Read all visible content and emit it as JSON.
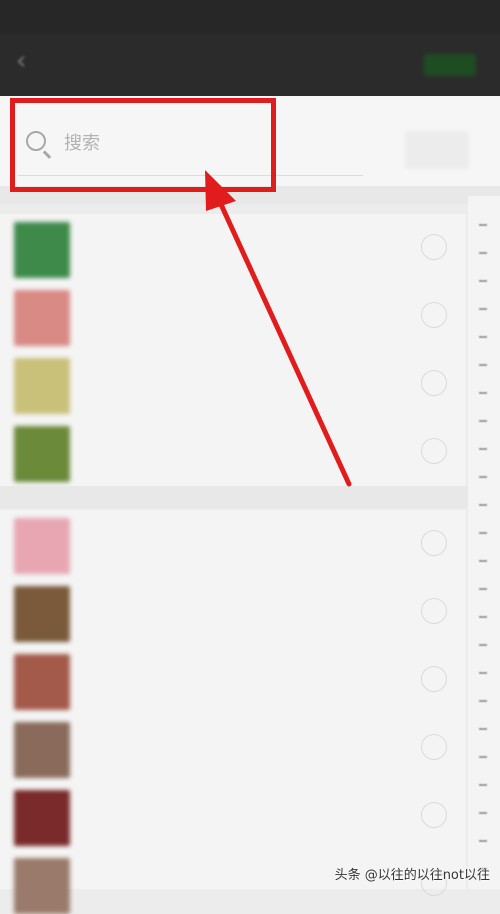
{
  "status_bar": {
    "carrier": "",
    "time": "",
    "battery": ""
  },
  "header": {
    "back_icon": "back-chevron-icon",
    "title": "",
    "done_label": ""
  },
  "search": {
    "placeholder": "搜索",
    "icon": "search-icon",
    "multi_select_label": ""
  },
  "sections": [
    {
      "header": "",
      "contacts": [
        {
          "name": "",
          "avatar_color": "#3e8a4a"
        },
        {
          "name": "",
          "avatar_color": "#d98a84"
        },
        {
          "name": "",
          "avatar_color": "#c9c07a"
        },
        {
          "name": "",
          "avatar_color": "#6b8a3a"
        }
      ]
    },
    {
      "header": "",
      "contacts": [
        {
          "name": "",
          "avatar_color": "#e7a6b2"
        },
        {
          "name": "",
          "avatar_color": "#7a5a3a"
        },
        {
          "name": "",
          "avatar_color": "#a45a4a"
        },
        {
          "name": "",
          "avatar_color": "#8a6a5a"
        },
        {
          "name": "",
          "avatar_color": "#7a2a2a"
        },
        {
          "name": "",
          "avatar_color": "#9a7a6a"
        }
      ]
    }
  ],
  "annotation": {
    "highlight_color": "#e01c1c",
    "target": "search-field"
  },
  "watermark": "头条 @以往的以往not以往"
}
